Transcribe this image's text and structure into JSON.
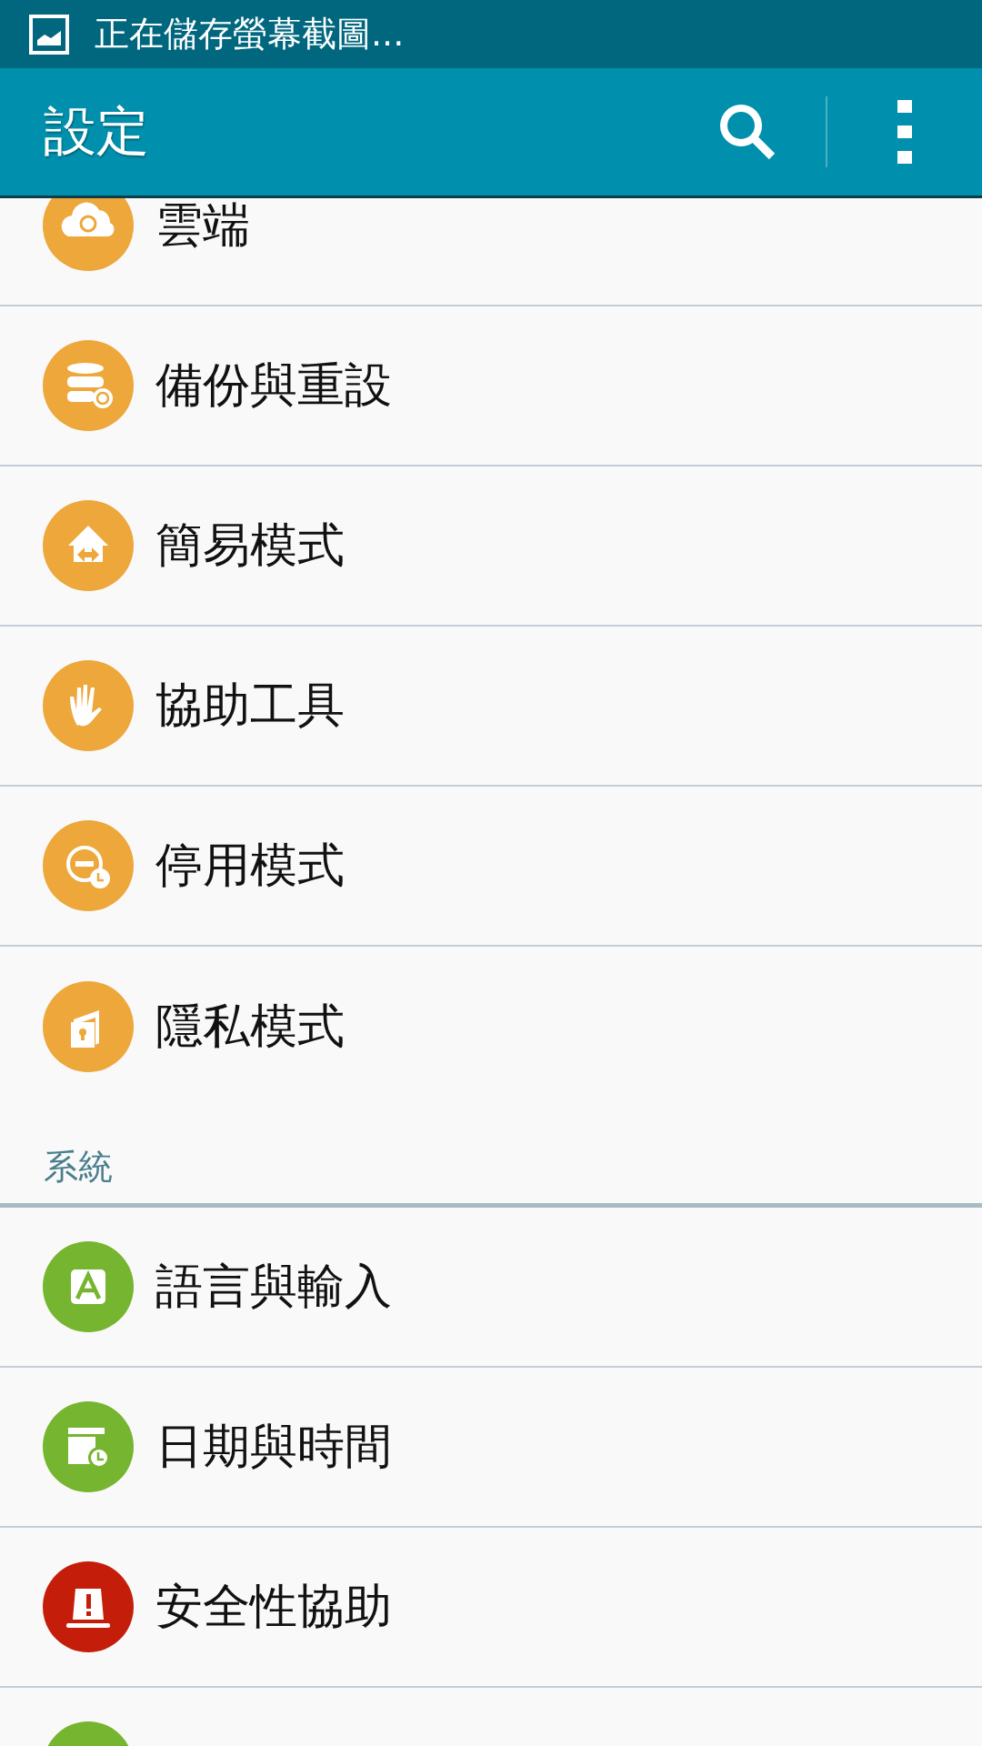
{
  "status_bar": {
    "notification": "正在儲存螢幕截圖..."
  },
  "app_bar": {
    "title": "設定"
  },
  "sections": [
    {
      "items": [
        {
          "kind": "cloud",
          "label": "雲端",
          "color": "#eda73b"
        },
        {
          "kind": "backup",
          "label": "備份與重設",
          "color": "#eda73b"
        },
        {
          "kind": "easy",
          "label": "簡易模式",
          "color": "#eda73b"
        },
        {
          "kind": "hand",
          "label": "協助工具",
          "color": "#eda73b"
        },
        {
          "kind": "block",
          "label": "停用模式",
          "color": "#eda73b"
        },
        {
          "kind": "private",
          "label": "隱私模式",
          "color": "#eda73b"
        }
      ]
    },
    {
      "header": "系統",
      "items": [
        {
          "kind": "language",
          "label": "語言與輸入",
          "color": "#76b52f"
        },
        {
          "kind": "calendar",
          "label": "日期與時間",
          "color": "#76b52f"
        },
        {
          "kind": "alert",
          "label": "安全性協助",
          "color": "#c41e0a"
        },
        {
          "kind": "partial",
          "color": "#76b52f"
        }
      ]
    }
  ]
}
